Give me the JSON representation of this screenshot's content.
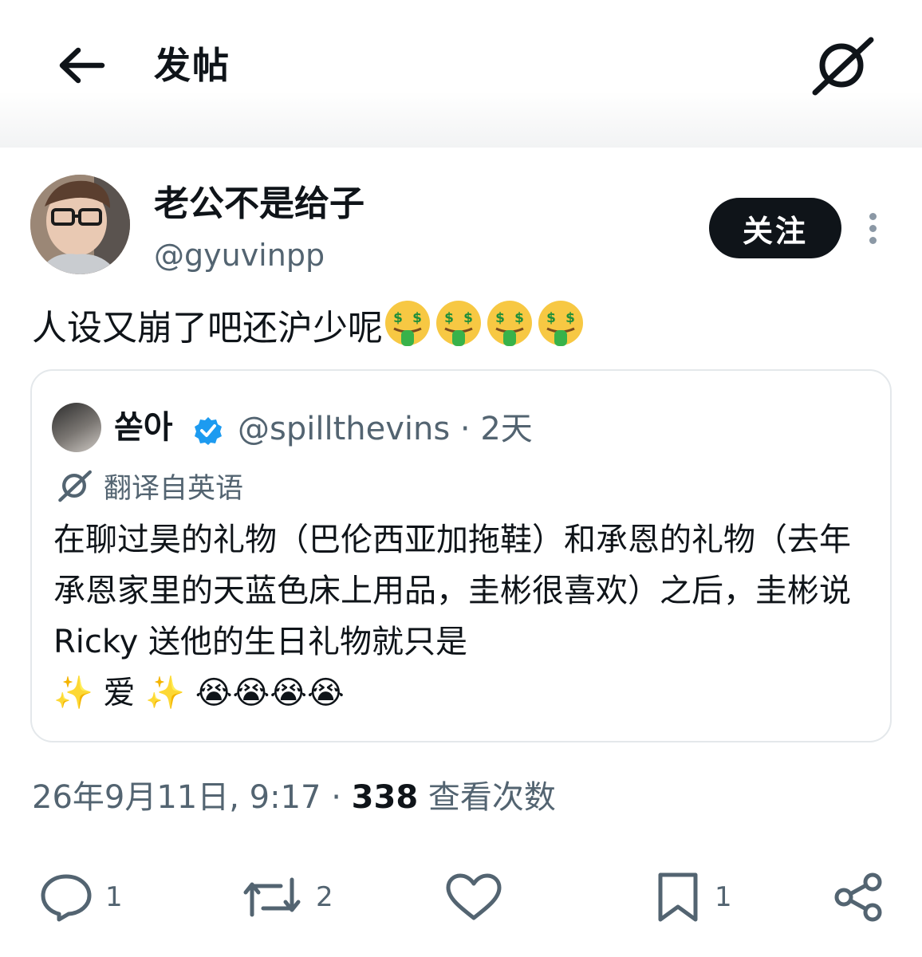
{
  "header": {
    "title": "发帖",
    "back_icon": "arrow-left-icon",
    "grok_icon": "grok-icon"
  },
  "author": {
    "display_name": "老公不是给子",
    "handle": "@gyuvinpp",
    "follow_label": "关注"
  },
  "tweet": {
    "text": "人设又崩了吧还沪少呢",
    "emoji": "🤑🤑🤑🤑"
  },
  "quote": {
    "display_name": "쏟아",
    "handle_time": "@spillthevins · 2天",
    "verified": true,
    "translate_label": "翻译自英语",
    "text": "在聊过昊的礼物（巴伦西亚加拖鞋）和承恩的礼物（去年承恩家里的天蓝色床上用品，圭彬很喜欢）之后，圭彬说 Ricky 送他的生日礼物就只是",
    "text_line2": "✨ 爱 ✨ 😭😭😭😭"
  },
  "meta": {
    "date_time": "26年9月11日, 9:17",
    "separator": "·",
    "views": "338",
    "views_label": "查看次数"
  },
  "actions": {
    "reply_count": "1",
    "retweet_count": "2",
    "like_count": "",
    "bookmark_count": "1"
  },
  "colors": {
    "text": "#0f1419",
    "secondary": "#536471",
    "verified": "#1d9bf0",
    "border": "#e4e8eb"
  }
}
